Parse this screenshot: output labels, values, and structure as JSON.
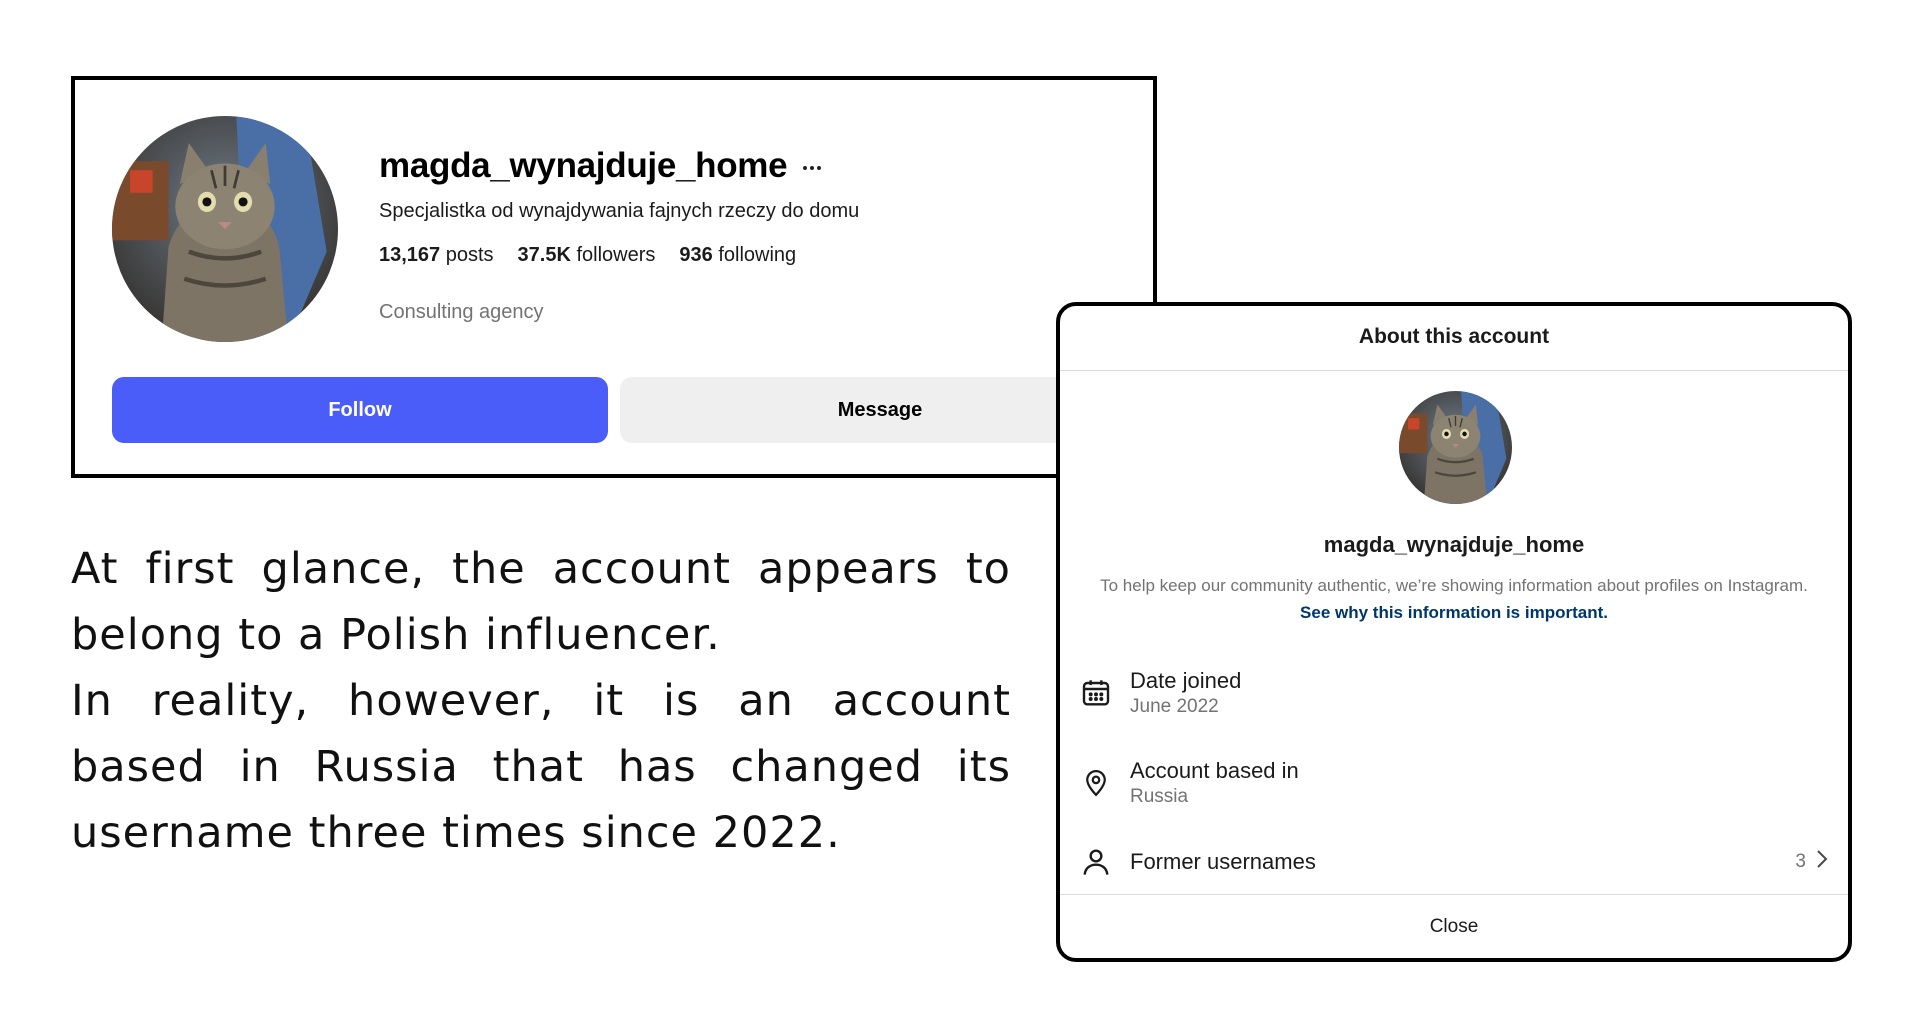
{
  "profile": {
    "username": "magda_wynajduje_home",
    "bio": "Specjalistka od wynajdywania fajnych rzeczy do domu",
    "stats": {
      "posts_count": "13,167",
      "posts_label": "posts",
      "followers_count": "37.5K",
      "followers_label": "followers",
      "following_count": "936",
      "following_label": "following"
    },
    "category": "Consulting agency",
    "follow_label": "Follow",
    "message_label": "Message",
    "more_icon": "more-horizontal-icon"
  },
  "caption": {
    "line1": "At first glance, the account appears to belong to a Polish influencer.",
    "line2": "In reality, however, it is an account based in Russia that has changed its username three times since 2022."
  },
  "about_modal": {
    "title": "About this account",
    "username": "magda_wynajduje_home",
    "info_text": "To help keep our community authentic, we’re showing information about profiles on Instagram.",
    "info_link": "See why this information is important.",
    "date_joined": {
      "label": "Date joined",
      "value": "June 2022",
      "icon": "calendar-icon"
    },
    "account_based": {
      "label": "Account based in",
      "value": "Russia",
      "icon": "location-pin-icon"
    },
    "former_usernames": {
      "label": "Former usernames",
      "count": "3",
      "icon": "person-icon"
    },
    "close_label": "Close"
  },
  "colors": {
    "follow_button": "#4a5df9",
    "message_button": "#efefef",
    "link": "#00376b",
    "muted_text": "#737373"
  }
}
